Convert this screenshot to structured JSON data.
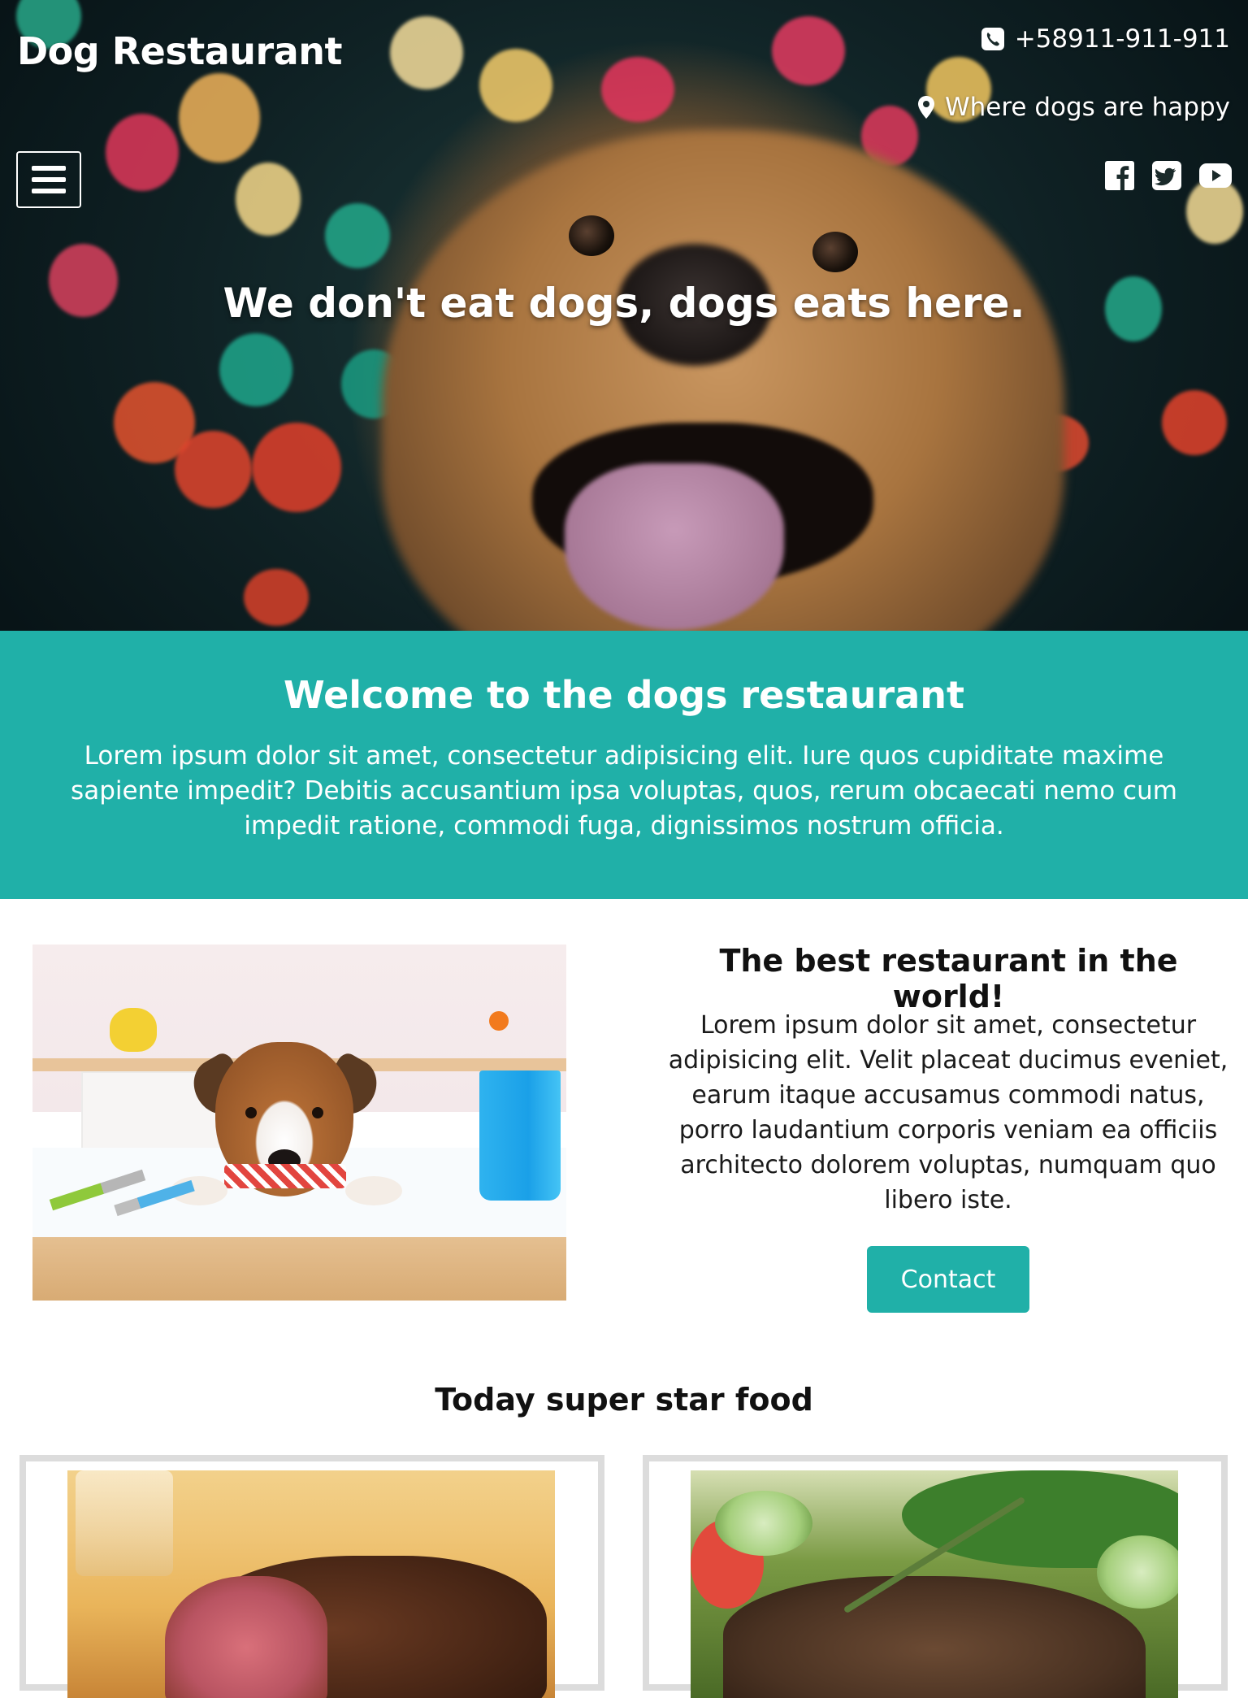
{
  "header": {
    "brand": "Dog Restaurant",
    "phone": "+58911-911-911",
    "location": "Where dogs are happy",
    "tagline": "We don't eat dogs, dogs eats here.",
    "menu_icon": "hamburger-menu-icon",
    "phone_icon": "phone-icon",
    "location_icon": "map-marker-icon",
    "social": [
      "facebook-icon",
      "twitter-icon",
      "youtube-icon"
    ]
  },
  "welcome": {
    "title": "Welcome to the dogs restaurant",
    "text": "Lorem ipsum dolor sit amet, consectetur adipisicing elit. Iure quos cupiditate maxime sapiente impedit? Debitis accusantium ipsa voluptas, quos, rerum obcaecati nemo cum impedit ratione, commodi fuga, dignissimos nostrum officia."
  },
  "about": {
    "title": "The best restaurant in the world!",
    "text": "Lorem ipsum dolor sit amet, consectetur adipisicing elit. Velit placeat ducimus eveniet, earum itaque accusamus commodi natus, porro laudantium corporis veniam ea officiis architecto dolorem voluptas, numquam quo libero iste.",
    "button_label": "Contact"
  },
  "food": {
    "heading": "Today super star food"
  },
  "colors": {
    "accent": "#20b0a8",
    "card_border": "#dcdcdc",
    "text_dark": "#111111"
  }
}
